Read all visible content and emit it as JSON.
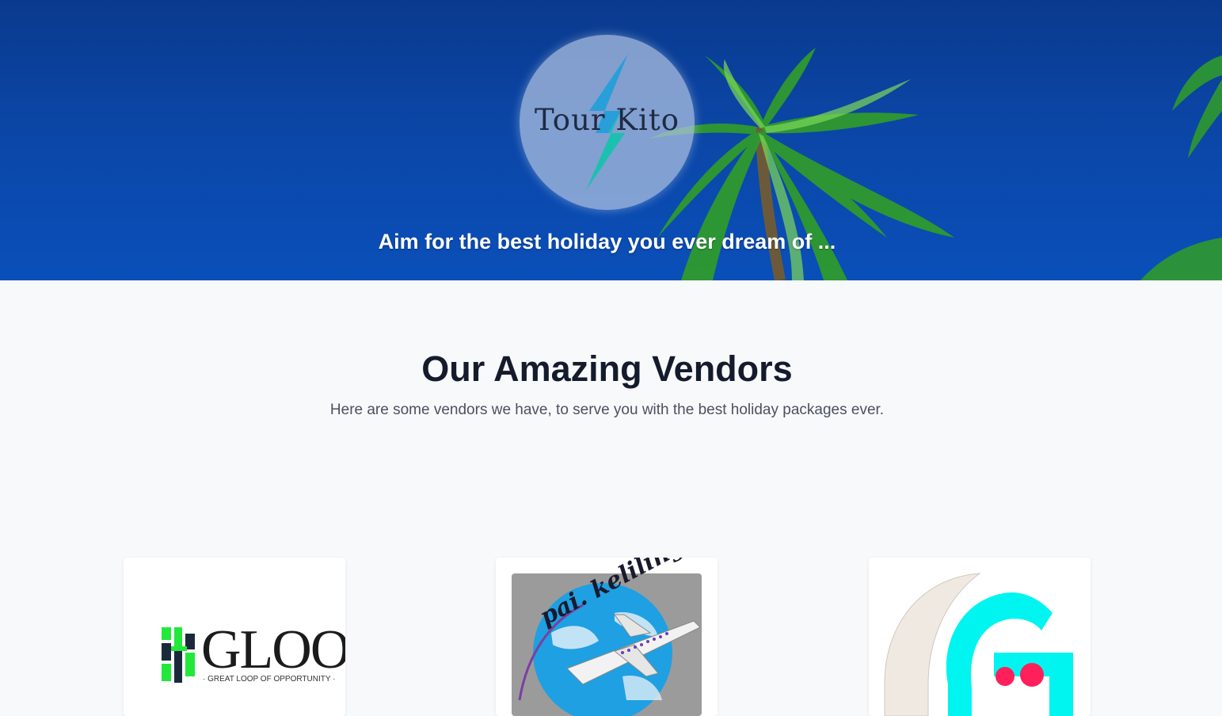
{
  "hero": {
    "logo_text": "Tour Kito",
    "tagline": "Aim for the best holiday you ever dream of ..."
  },
  "vendors_section": {
    "title": "Our Amazing Vendors",
    "subtitle": "Here are some vendors we have, to serve you with the best holiday packages ever."
  },
  "vendors": [
    {
      "logo_text": "GLOO",
      "logo_subtext": "· GREAT LOOP OF OPPORTUNITY ·"
    },
    {
      "logo_text": "pai. keliling"
    },
    {
      "logo_text": ""
    }
  ],
  "colors": {
    "hero_blue": "#0b46a6",
    "page_background": "#f8f9fb",
    "title_text": "#141b2d",
    "gloo_green": "#22e83a",
    "vendor3_cyan": "#00f5f0",
    "vendor3_pink": "#ff1f5a"
  }
}
